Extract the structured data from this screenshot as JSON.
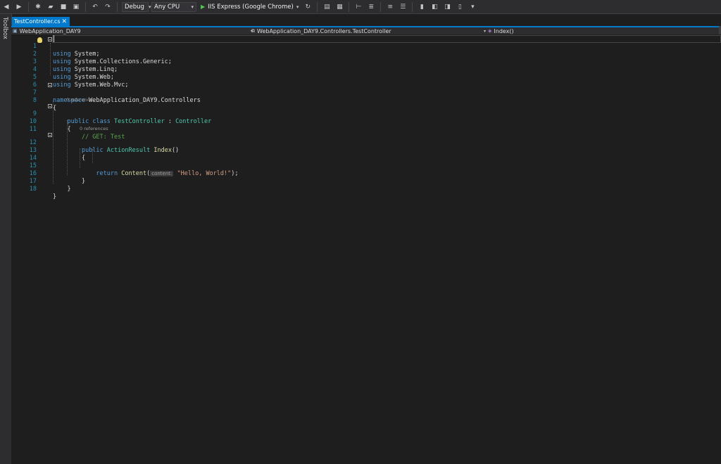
{
  "toolbar": {
    "config": "Debug",
    "platform": "Any CPU",
    "run_target": "IIS Express (Google Chrome)"
  },
  "toolbox": {
    "label": "Toolbox"
  },
  "tab": {
    "label": "TestController.cs",
    "close": "✕"
  },
  "navbar": {
    "project": "WebApplication_DAY9",
    "class": "WebApplication_DAY9.Controllers.TestController",
    "member": "Index()"
  },
  "editor": {
    "line_numbers": [
      "1",
      "2",
      "3",
      "4",
      "5",
      "6",
      "7",
      "8",
      "9",
      "10",
      "11",
      "12",
      "13",
      "14",
      "15",
      "16",
      "17",
      "18"
    ],
    "lens": [
      "0 references",
      "0 references"
    ],
    "code": {
      "using": "using",
      "ns1": " System;",
      "ns2": " System.Collections.Generic;",
      "ns3": " System.Linq;",
      "ns4": " System.Web;",
      "ns5": " System.Web.Mvc;",
      "namespace_kw": "namespace",
      "namespace_name": " WebApplication_DAY9.Controllers",
      "open_brace": "{",
      "close_brace": "}",
      "public": "public",
      "class": "class",
      "class_name": "TestController",
      "colon": " : ",
      "base": "Controller",
      "comment": "// GET: Test",
      "action_result": "ActionResult",
      "method": "Index",
      "parens": "()",
      "return": "return",
      "content": "Content",
      "open_paren": "(",
      "hint": "content:",
      "string": "\"Hello, World!\"",
      "end": ");"
    }
  },
  "colors": {
    "keyword": "#569cd6",
    "type": "#4ec9b0",
    "comment": "#57a64a",
    "string": "#d69d85",
    "accent": "#007acc"
  }
}
